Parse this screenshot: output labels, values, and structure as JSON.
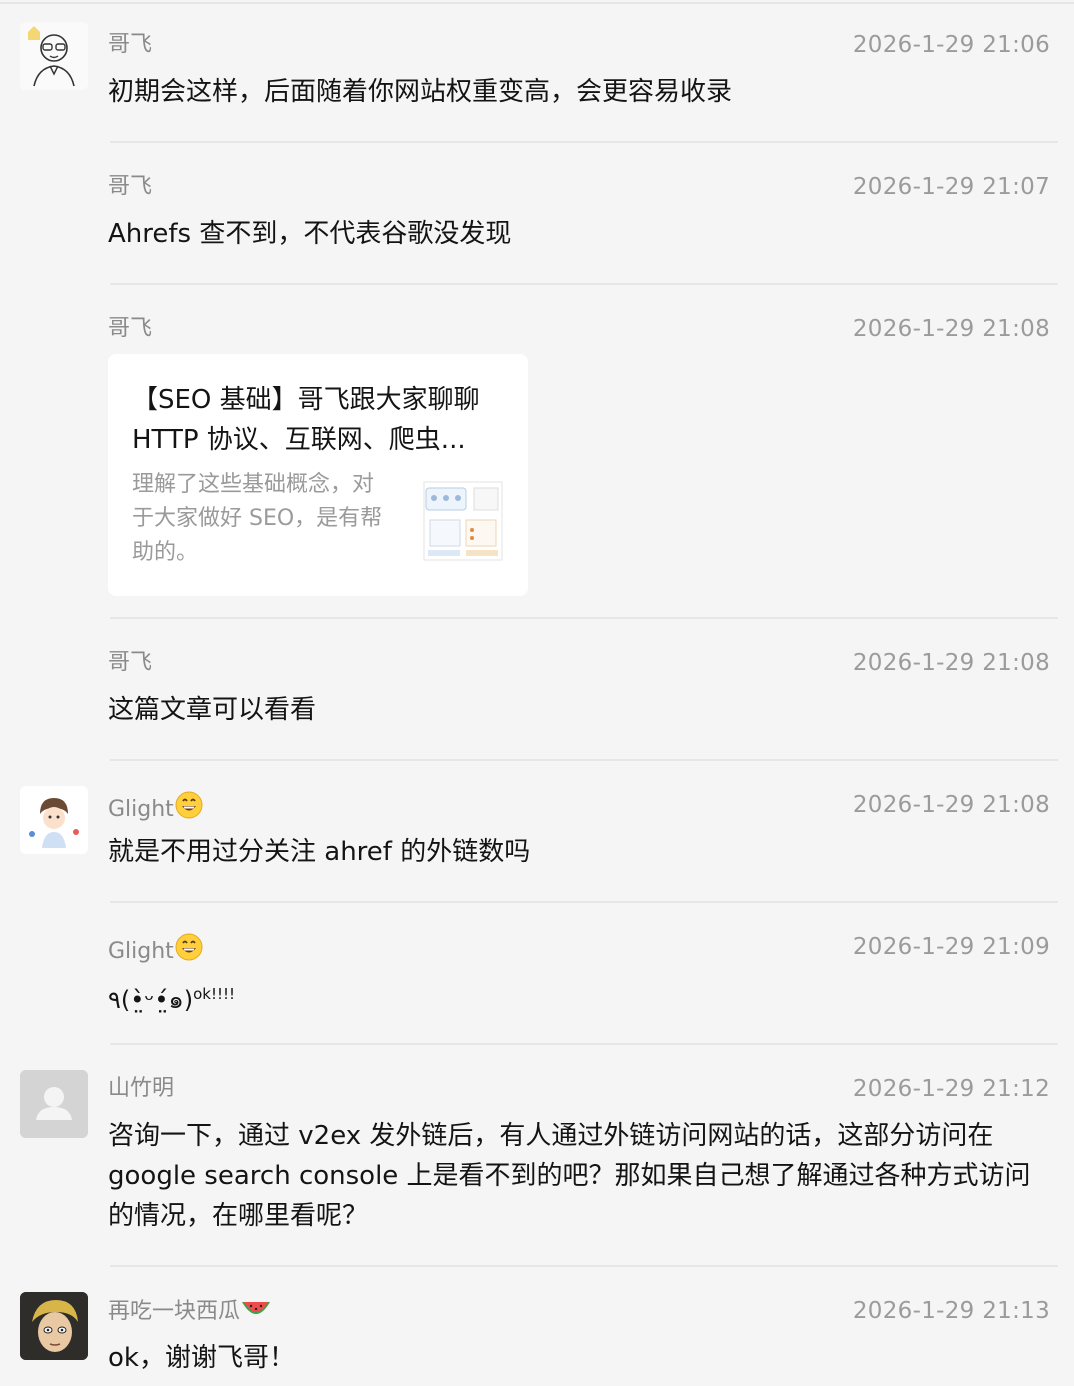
{
  "comments": [
    {
      "name": "哥飞",
      "time": "2026-1-29 21:06",
      "text": "初期会这样，后面随着你网站权重变高，会更容易收录"
    },
    {
      "name": "哥飞",
      "time": "2026-1-29 21:07",
      "text": "Ahrefs 查不到，不代表谷歌没发现"
    },
    {
      "name": "哥飞",
      "time": "2026-1-29 21:08",
      "card": {
        "title": "【SEO 基础】哥飞跟大家聊聊 HTTP 协议、互联网、爬虫...",
        "desc": "理解了这些基础概念，对于大家做好 SEO，是有帮助的。"
      }
    },
    {
      "name": "哥飞",
      "time": "2026-1-29 21:08",
      "text": "这篇文章可以看看"
    },
    {
      "name": "Glight",
      "name_emoji": "grinning-face-emoji",
      "time": "2026-1-29 21:08",
      "text": "就是不用过分关注 ahref 的外链数吗"
    },
    {
      "name": "Glight",
      "name_emoji": "grinning-face-emoji",
      "time": "2026-1-29 21:09",
      "text": "٩(•̤̀ᵕ•̤́๑)",
      "text_sup": "ok!!!!"
    },
    {
      "name": "山竹明",
      "time": "2026-1-29 21:12",
      "text": "咨询一下，通过 v2ex 发外链后，有人通过外链访问网站的话，这部分访问在 google search console 上是看不到的吧？那如果自己想了解通过各种方式访问的情况，在哪里看呢？"
    },
    {
      "name": "再吃一块西瓜",
      "name_emoji": "watermelon-emoji",
      "time": "2026-1-29 21:13",
      "text": "ok，谢谢飞哥！"
    }
  ],
  "colors": {
    "background": "#f5f5f5",
    "name": "#8a8a8a",
    "time": "#9b9b9b",
    "text": "#141414",
    "divider": "#e6e6e6"
  }
}
